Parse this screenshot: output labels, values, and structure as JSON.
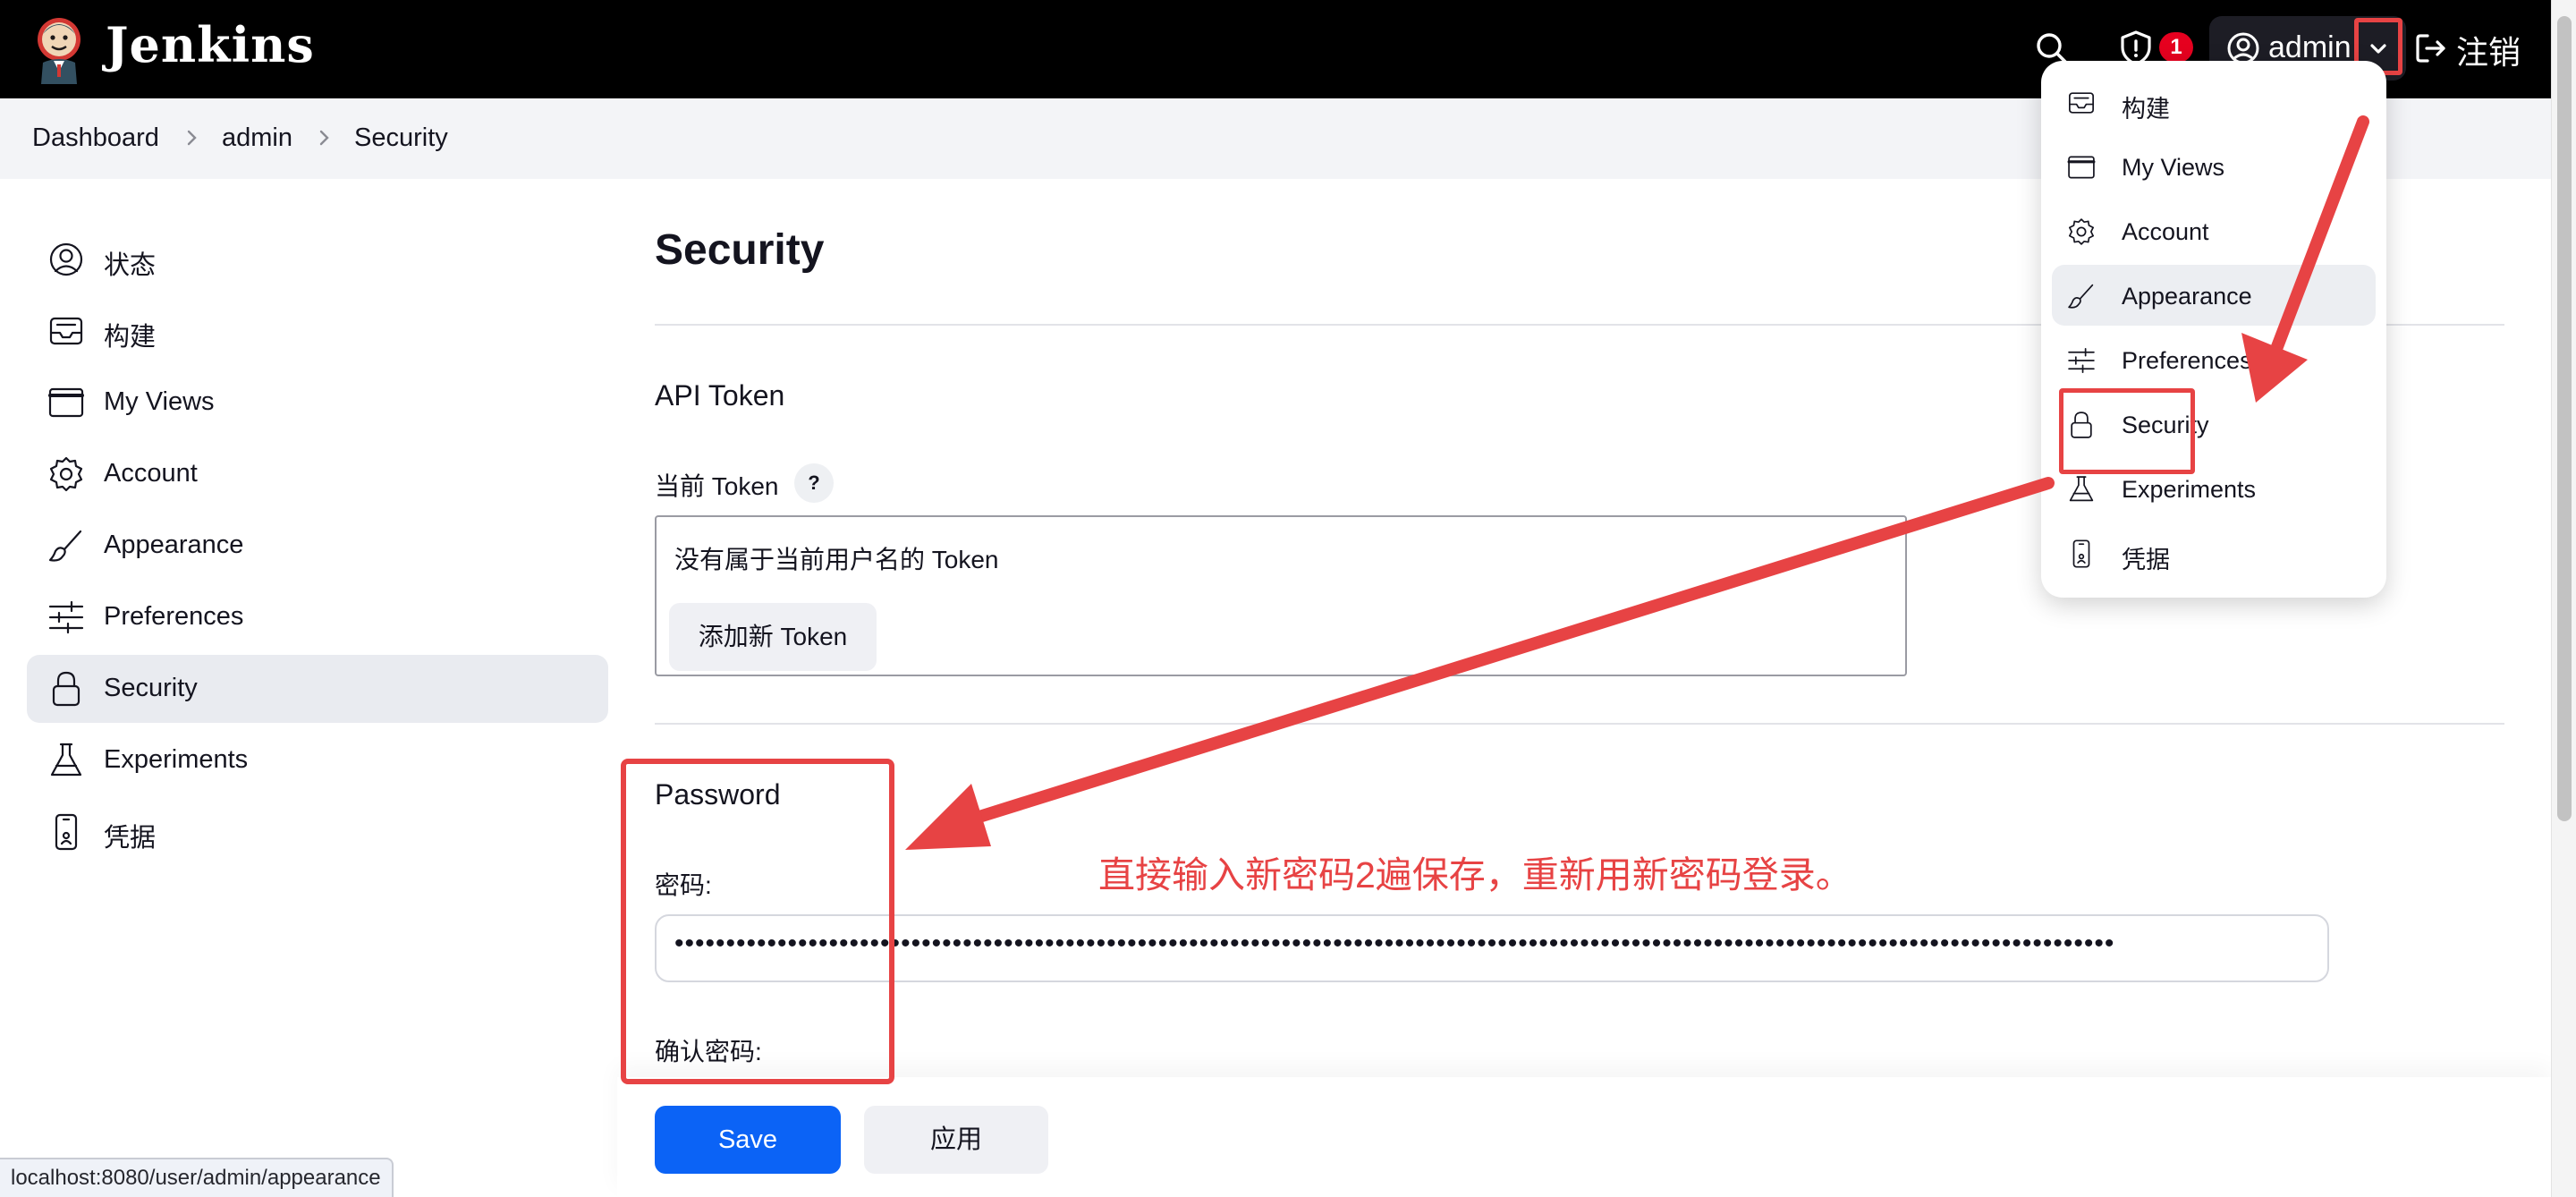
{
  "header": {
    "brand": "Jenkins",
    "security_badge_count": "1",
    "user_name": "admin",
    "logout_label": "注销"
  },
  "breadcrumb": {
    "items": [
      "Dashboard",
      "admin",
      "Security"
    ]
  },
  "sidebar": {
    "items": [
      {
        "label": "状态",
        "icon": "user-circle-icon"
      },
      {
        "label": "构建",
        "icon": "inbox-icon"
      },
      {
        "label": "My Views",
        "icon": "window-icon"
      },
      {
        "label": "Account",
        "icon": "gear-icon"
      },
      {
        "label": "Appearance",
        "icon": "brush-icon"
      },
      {
        "label": "Preferences",
        "icon": "sliders-icon"
      },
      {
        "label": "Security",
        "icon": "lock-icon",
        "active": true
      },
      {
        "label": "Experiments",
        "icon": "flask-icon"
      },
      {
        "label": "凭据",
        "icon": "phone-icon"
      }
    ]
  },
  "main": {
    "title": "Security",
    "api_token": {
      "section_title": "API Token",
      "current_token_label": "当前 Token",
      "help": "?",
      "empty_text": "没有属于当前用户名的 Token",
      "add_button": "添加新 Token"
    },
    "password": {
      "section_title": "Password",
      "password_label": "密码:",
      "password_value": "••••••••••••••••••••••••••••••••••••••••••••••••••••••••••••••••••••••••••••••••••••••••••••••••••••••••••••••••••••••••••••••••••••••••••••",
      "confirm_label": "确认密码:"
    },
    "save_button": "Save",
    "apply_button": "应用"
  },
  "dropdown": {
    "items": [
      {
        "label": "构建",
        "icon": "inbox-icon"
      },
      {
        "label": "My Views",
        "icon": "window-icon"
      },
      {
        "label": "Account",
        "icon": "gear-icon"
      },
      {
        "label": "Appearance",
        "icon": "brush-icon",
        "hovered": true
      },
      {
        "label": "Preferences",
        "icon": "sliders-icon"
      },
      {
        "label": "Security",
        "icon": "lock-icon",
        "highlighted": true
      },
      {
        "label": "Experiments",
        "icon": "flask-icon"
      },
      {
        "label": "凭据",
        "icon": "phone-icon"
      }
    ]
  },
  "annotation": {
    "note": "直接输入新密码2遍保存，重新用新密码登录。",
    "color": "#e74344"
  },
  "status_bar": {
    "url": "localhost:8080/user/admin/appearance"
  },
  "colors": {
    "header_bg": "#000000",
    "primary_button": "#0b63f6",
    "badge": "#e6001f"
  }
}
